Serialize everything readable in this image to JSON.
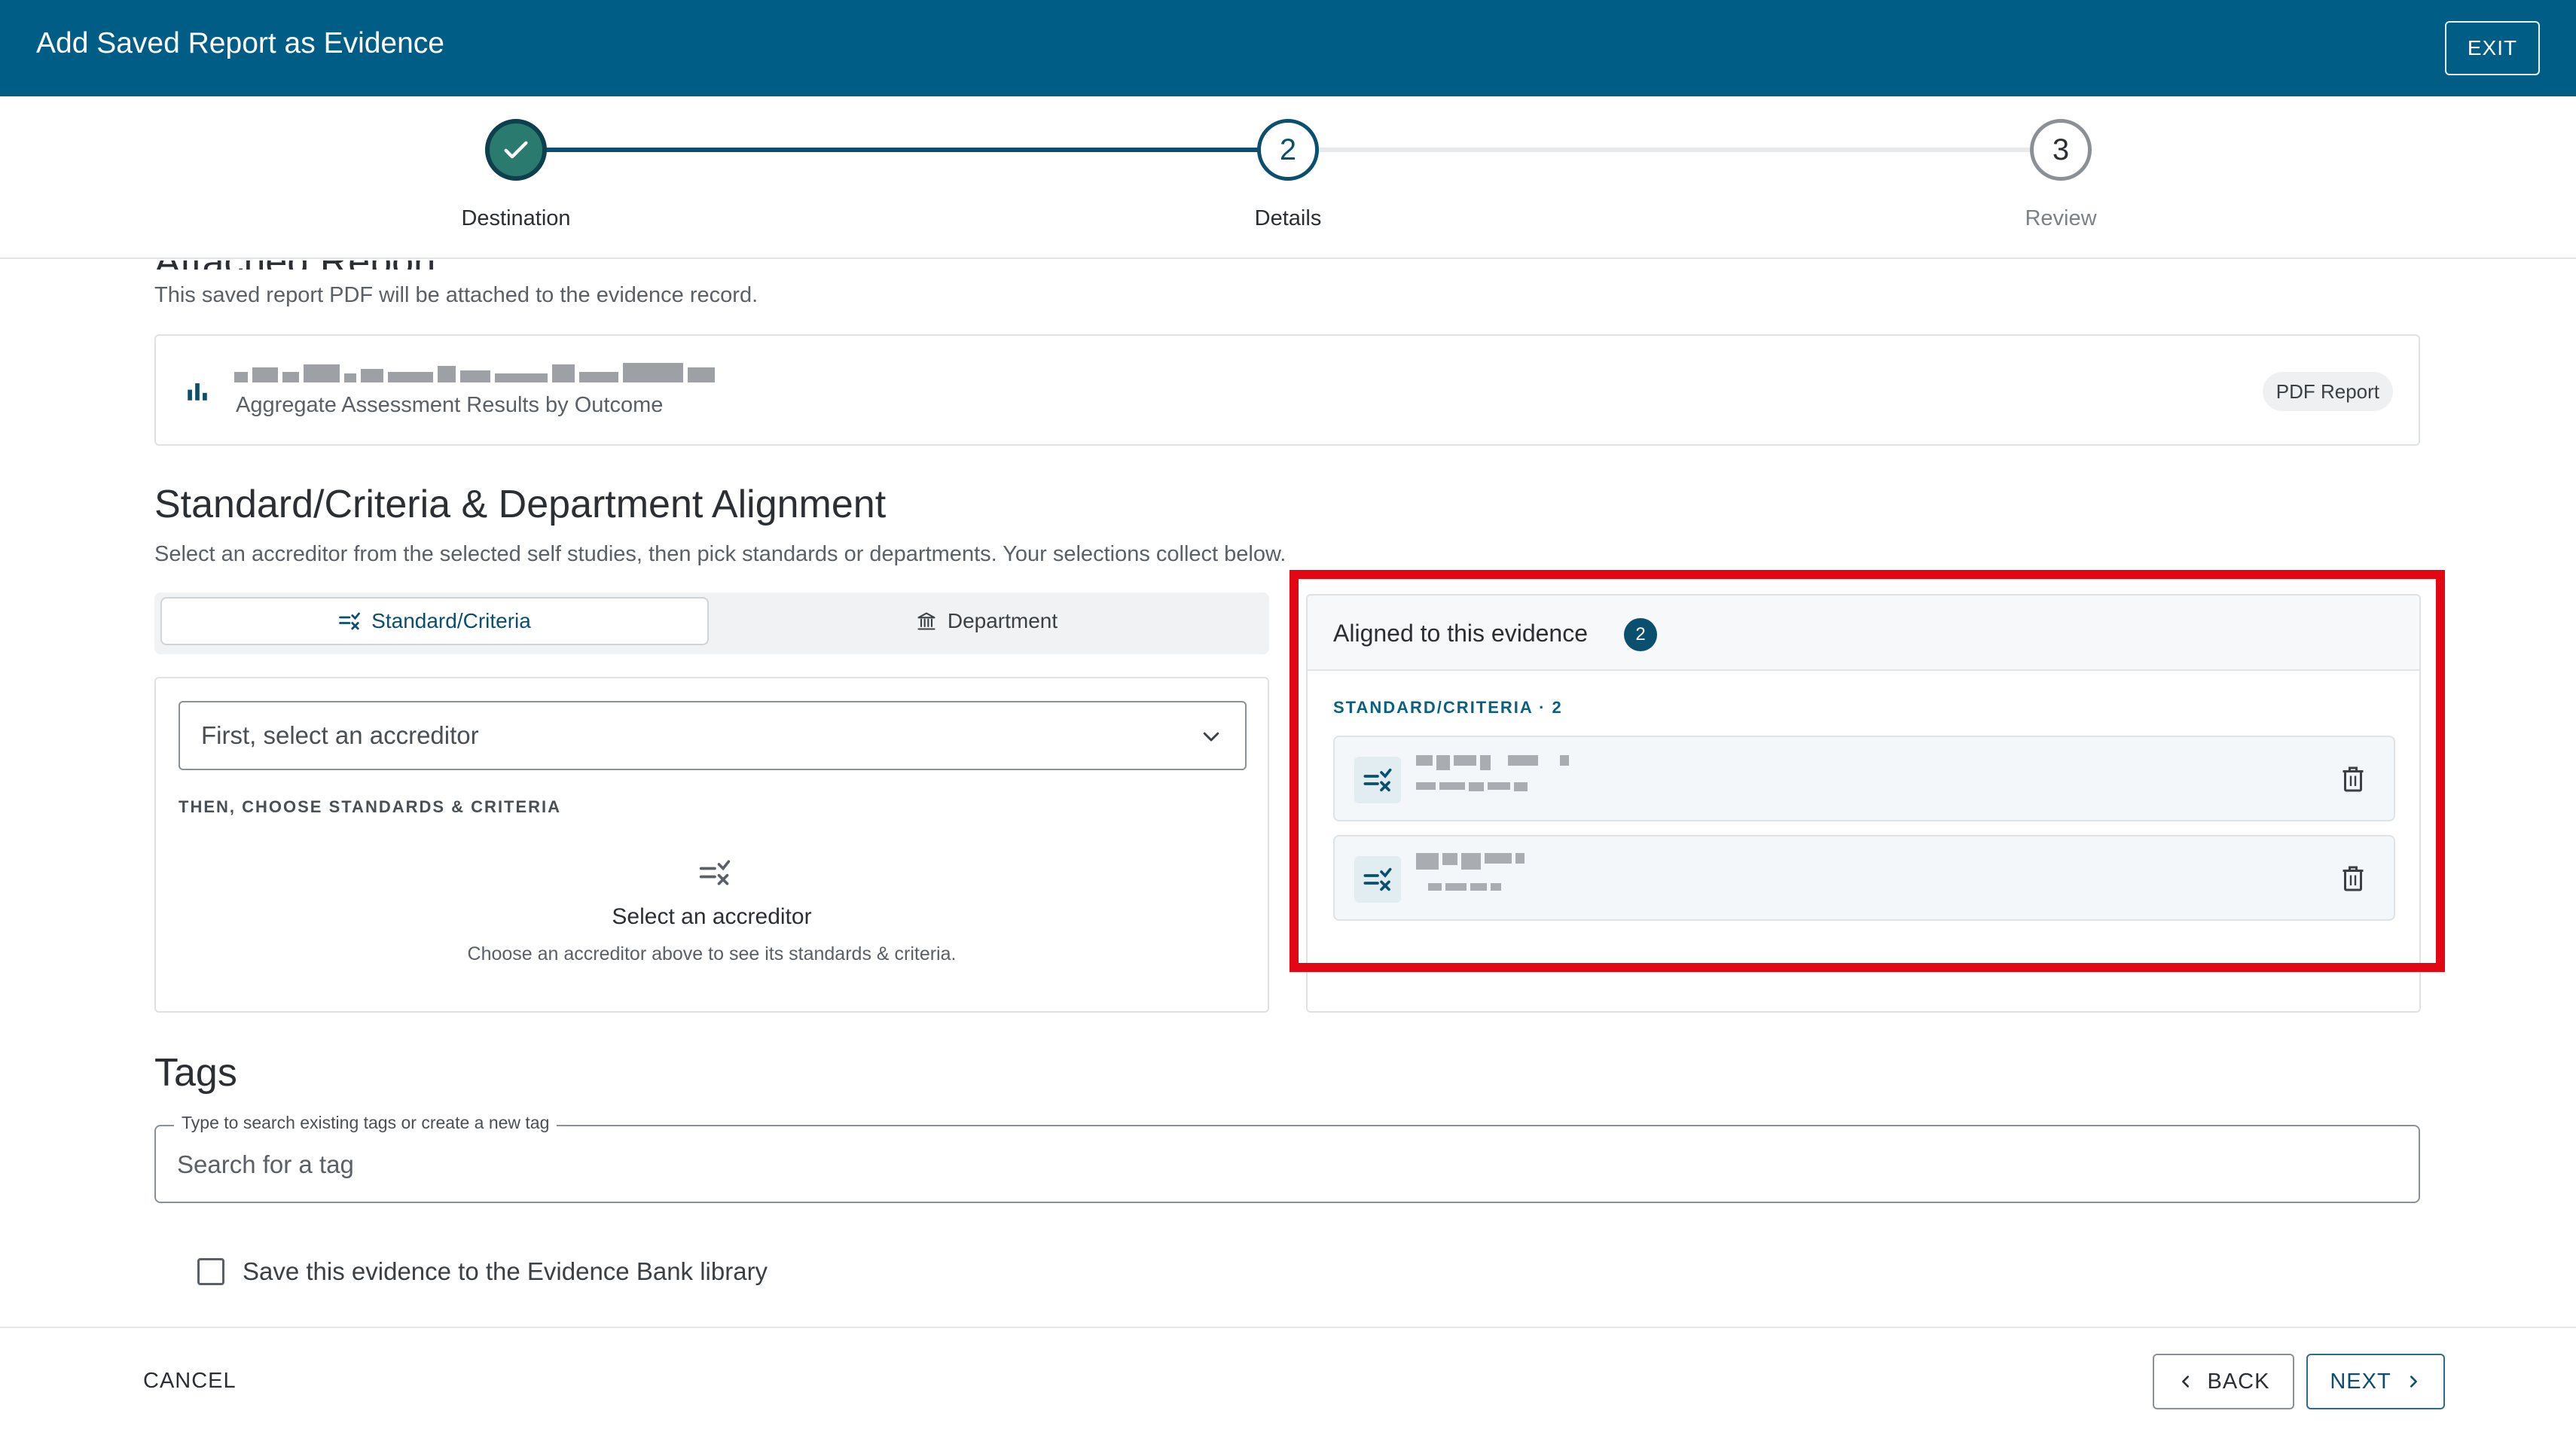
{
  "header": {
    "title": "Add Saved Report as Evidence",
    "exit_label": "EXIT"
  },
  "stepper": {
    "steps": [
      {
        "number": "1",
        "label": "Destination",
        "state": "complete"
      },
      {
        "number": "2",
        "label": "Details",
        "state": "active"
      },
      {
        "number": "3",
        "label": "Review",
        "state": "pending"
      }
    ]
  },
  "attached_report": {
    "heading": "Attached Report",
    "description": "This saved report PDF will be attached to the evidence record.",
    "icon": "bar-chart-icon",
    "subtitle": "Aggregate Assessment Results by Outcome",
    "badge": "PDF Report"
  },
  "alignment": {
    "title": "Standard/Criteria & Department Alignment",
    "description": "Select an accreditor from the selected self studies, then pick standards or departments. Your selections collect below.",
    "tabs": [
      {
        "label": "Standard/Criteria",
        "icon": "standards-icon",
        "active": true
      },
      {
        "label": "Department",
        "icon": "institution-icon",
        "active": false
      }
    ],
    "accreditor_select": {
      "value": "First, select an accreditor"
    },
    "choose_label": "THEN, CHOOSE STANDARDS & CRITERIA",
    "empty_state": {
      "title": "Select an accreditor",
      "subtitle": "Choose an accreditor above to see its standards & criteria."
    },
    "aligned": {
      "title": "Aligned to this evidence",
      "count": "2",
      "group_label": "STANDARD/CRITERIA · 2"
    }
  },
  "tags": {
    "title": "Tags",
    "legend": "Type to search existing tags or create a new tag",
    "placeholder": "Search for a tag"
  },
  "save_option": {
    "label": "Save this evidence to the Evidence Bank library",
    "checked": false
  },
  "footer": {
    "cancel_label": "CANCEL",
    "back_label": "BACK",
    "next_label": "NEXT"
  },
  "colors": {
    "header": "#005e86",
    "accent": "#0b4f6f",
    "complete": "#2a7a70",
    "highlight": "#e30613"
  }
}
